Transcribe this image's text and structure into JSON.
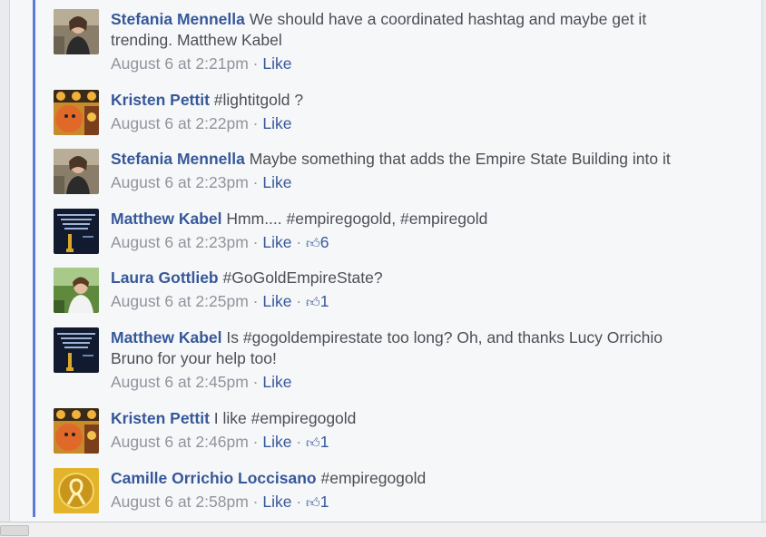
{
  "comments": [
    {
      "author": "Stefania Mennella",
      "text": "We should have a coordinated hashtag and maybe get it",
      "text2": "trending. Matthew Kabel",
      "time": "August 6 at 2:21pm",
      "like_label": "Like",
      "likes": "",
      "avatar": "woman-photo"
    },
    {
      "author": "Kristen Pettit",
      "text": "#lightitgold ?",
      "time": "August 6 at 2:22pm",
      "like_label": "Like",
      "likes": "",
      "avatar": "orange-face-graphic"
    },
    {
      "author": "Stefania Mennella",
      "text": "Maybe something that adds the Empire State Building into it",
      "time": "August 6 at 2:23pm",
      "like_label": "Like",
      "likes": "",
      "avatar": "woman-photo"
    },
    {
      "author": "Matthew Kabel",
      "text": "Hmm.... #empiregogold, #empiregold",
      "time": "August 6 at 2:23pm",
      "like_label": "Like",
      "likes": "6",
      "avatar": "dark-poster"
    },
    {
      "author": "Laura Gottlieb",
      "text": "#GoGoldEmpireState?",
      "time": "August 6 at 2:25pm",
      "like_label": "Like",
      "likes": "1",
      "avatar": "outdoor-photo"
    },
    {
      "author": "Matthew Kabel",
      "text": "Is #gogoldempirestate too long? Oh, and thanks Lucy Orrichio",
      "text2": "Bruno for your help too!",
      "time": "August 6 at 2:45pm",
      "like_label": "Like",
      "likes": "",
      "avatar": "dark-poster"
    },
    {
      "author": "Kristen Pettit",
      "text": "I like #empiregogold",
      "time": "August 6 at 2:46pm",
      "like_label": "Like",
      "likes": "1",
      "avatar": "orange-face-graphic"
    },
    {
      "author": "Camille Orrichio Loccisano",
      "text": "#empiregogold",
      "time": "August 6 at 2:58pm",
      "like_label": "Like",
      "likes": "1",
      "avatar": "gold-ribbon-icon"
    }
  ],
  "separator": "·",
  "thumb_icon": "thumbs-up-icon",
  "colors": {
    "link": "#365899",
    "text": "#4b4f56",
    "meta": "#90949c",
    "accent": "#5b7bd5"
  }
}
